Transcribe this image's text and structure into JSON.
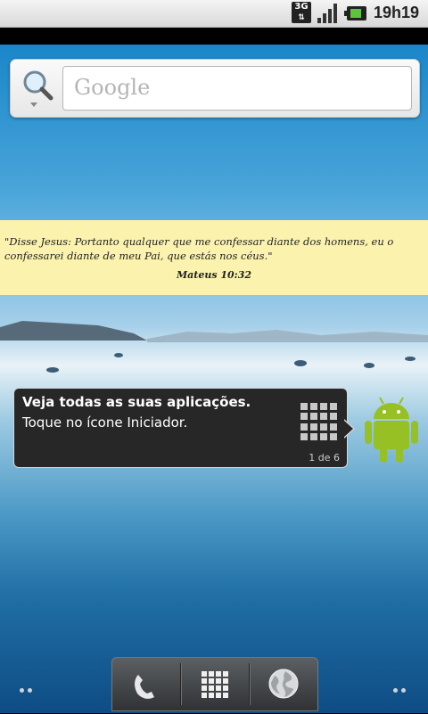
{
  "status_bar": {
    "network_type": "3G",
    "time": "19h19",
    "icons": [
      "3g-icon",
      "signal-icon",
      "battery-icon"
    ]
  },
  "search_widget": {
    "placeholder": "Google",
    "icon": "search-icon"
  },
  "verse": {
    "text": "\"Disse Jesus: Portanto qualquer que me confessar diante dos homens, eu o confessarei diante de meu Pai, que estás nos céus.\"",
    "reference": "Mateus 10:32"
  },
  "tip": {
    "title": "Veja todas as suas aplicações.",
    "body": "Toque no ícone Iniciador.",
    "page": "1 de 6",
    "icon": "launcher-grid-icon"
  },
  "dock": {
    "items": [
      "phone-icon",
      "launcher-grid-icon",
      "browser-globe-icon"
    ]
  },
  "colors": {
    "verse_background": "#fbf3ad",
    "tip_background": "#272727",
    "android_green": "#97c024"
  }
}
